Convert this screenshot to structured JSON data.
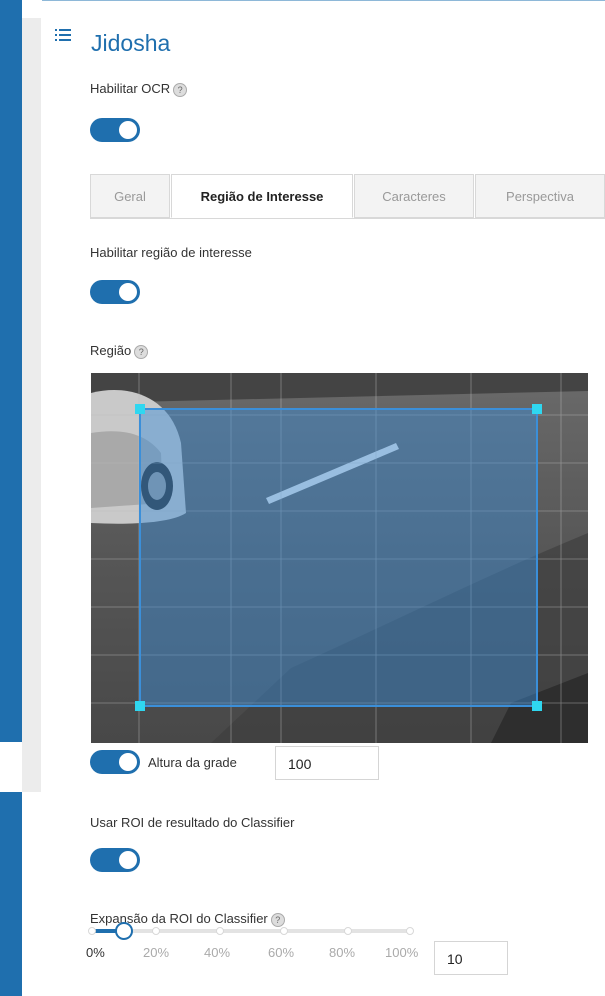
{
  "title": "Jidosha",
  "enable_ocr": {
    "label": "Habilitar OCR",
    "on": true
  },
  "tabs": [
    {
      "label": "Geral",
      "active": false
    },
    {
      "label": "Região de Interesse",
      "active": true
    },
    {
      "label": "Caracteres",
      "active": false
    },
    {
      "label": "Perspectiva",
      "active": false
    }
  ],
  "enable_roi": {
    "label": "Habilitar região de interesse",
    "on": true
  },
  "region": {
    "label": "Região"
  },
  "grid": {
    "toggle_on": true,
    "label": "Altura da grade",
    "value": "100"
  },
  "classifier_roi": {
    "label": "Usar ROI de resultado do Classifier",
    "on": true
  },
  "expansion": {
    "label": "Expansão da ROI do Classifier",
    "value": "10",
    "fraction": 0.1,
    "ticks": [
      "0%",
      "20%",
      "40%",
      "60%",
      "80%",
      "100%"
    ]
  },
  "colors": {
    "accent": "#1f6fae",
    "roi_fill": "#3b8fd9",
    "roi_handle": "#2fd7f0"
  },
  "icons": {
    "menu": "list-icon",
    "help": "help-icon"
  }
}
